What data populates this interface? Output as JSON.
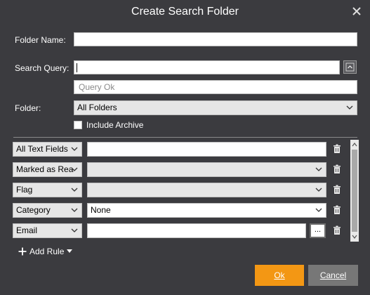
{
  "dialog": {
    "title": "Create Search Folder",
    "close_glyph": "✕"
  },
  "form": {
    "folder_name_label": "Folder Name:",
    "folder_name_value": "",
    "search_query_label": "Search Query:",
    "search_query_value": "",
    "query_status": "Query Ok",
    "folder_label": "Folder:",
    "folder_selected": "All Folders",
    "include_archive_label": "Include Archive",
    "include_archive_checked": false
  },
  "rules": [
    {
      "field": "All Text Fields",
      "value": "",
      "value_type": "text"
    },
    {
      "field": "Marked as Rea",
      "value": "",
      "value_type": "select"
    },
    {
      "field": "Flag",
      "value": "",
      "value_type": "select"
    },
    {
      "field": "Category",
      "value": "None",
      "value_type": "select-white"
    },
    {
      "field": "Email",
      "value": "",
      "value_type": "text-browse",
      "browse_label": "..."
    }
  ],
  "footer": {
    "add_rule_label": "Add Rule",
    "ok_label": "Ok",
    "cancel_label": "Cancel"
  },
  "colors": {
    "background": "#3b3b3f",
    "accent": "#f39714",
    "cancel": "#777777"
  },
  "icons": [
    "close-icon",
    "expand-up-icon",
    "chevron-down-icon",
    "trash-icon",
    "plus-icon",
    "caret-down-icon"
  ]
}
